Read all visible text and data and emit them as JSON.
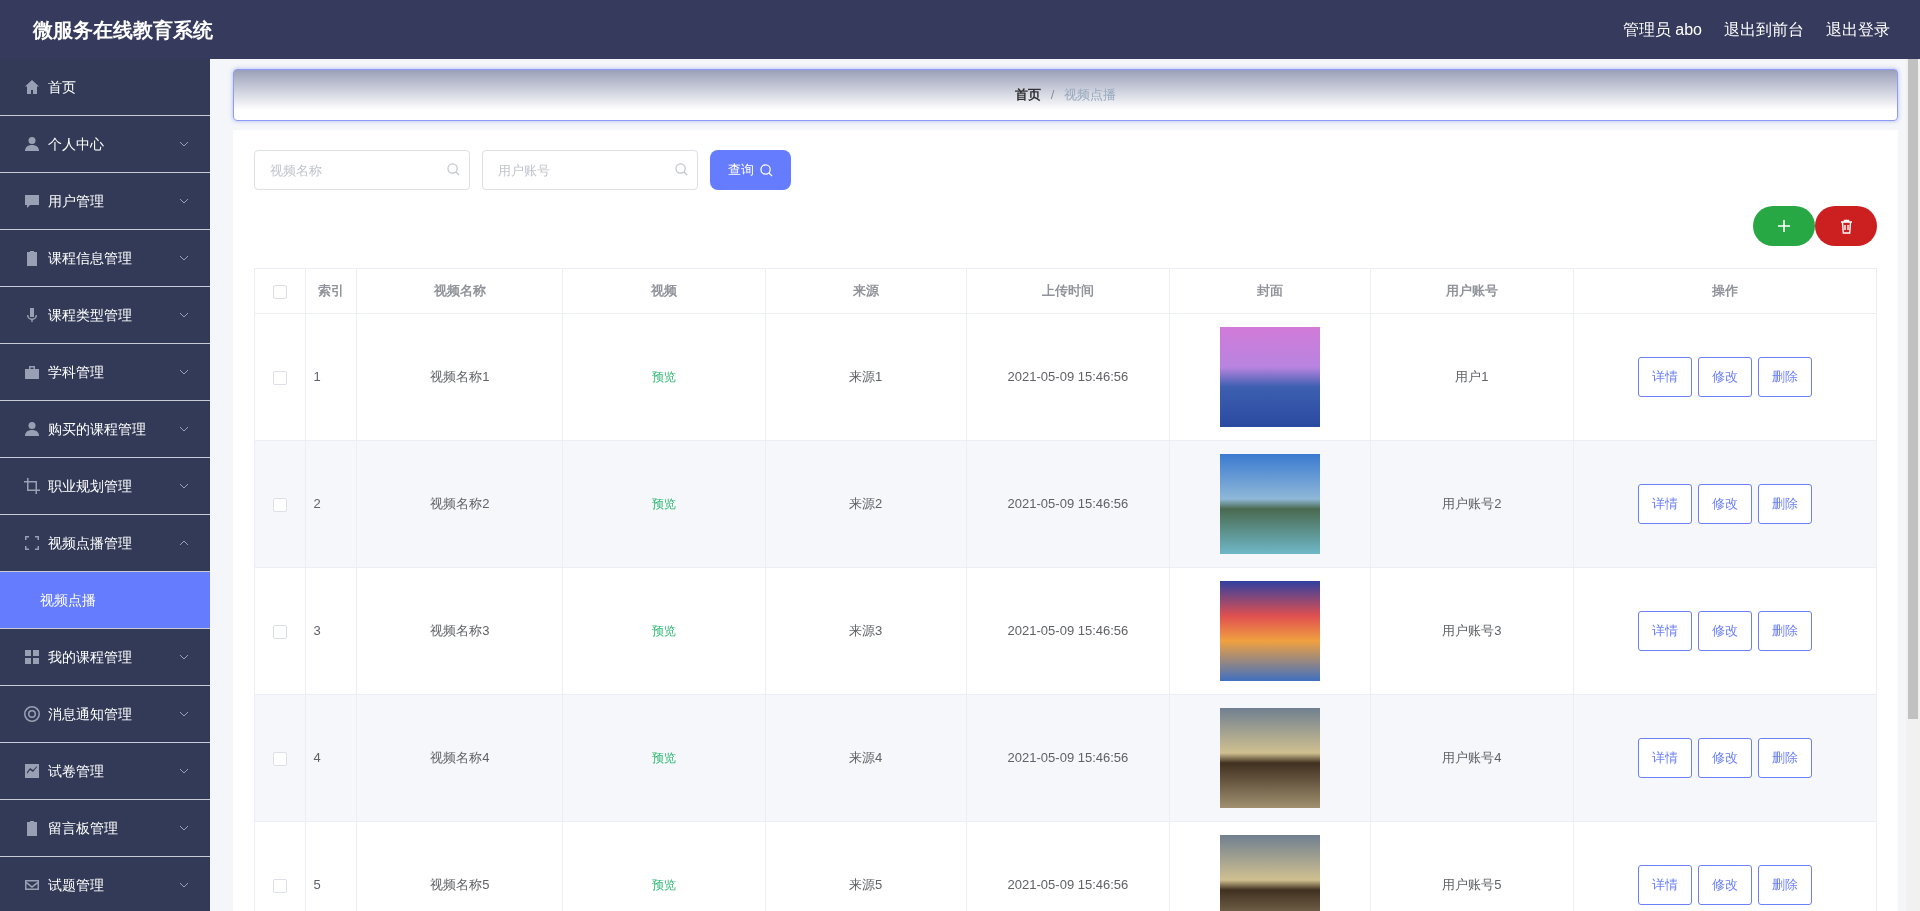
{
  "header": {
    "title": "微服务在线教育系统",
    "links": [
      {
        "label": "管理员 abo"
      },
      {
        "label": "退出到前台"
      },
      {
        "label": "退出登录"
      }
    ]
  },
  "sidebar": {
    "items": [
      {
        "label": "首页"
      },
      {
        "label": "个人中心",
        "expanded": false
      },
      {
        "label": "用户管理",
        "expanded": false
      },
      {
        "label": "课程信息管理",
        "expanded": false
      },
      {
        "label": "课程类型管理",
        "expanded": false
      },
      {
        "label": "学科管理",
        "expanded": false
      },
      {
        "label": "购买的课程管理",
        "expanded": false
      },
      {
        "label": "职业规划管理",
        "expanded": false
      },
      {
        "label": "视频点播管理",
        "expanded": true,
        "children": [
          {
            "label": "视频点播",
            "selected": true
          }
        ]
      },
      {
        "label": "我的课程管理",
        "expanded": false
      },
      {
        "label": "消息通知管理",
        "expanded": false
      },
      {
        "label": "试卷管理",
        "expanded": false
      },
      {
        "label": "留言板管理",
        "expanded": false
      },
      {
        "label": "试题管理",
        "expanded": false
      }
    ]
  },
  "breadcrumb": [
    {
      "label": "首页"
    },
    {
      "label": "视频点播"
    }
  ],
  "breadcrumb_separator": "/",
  "search": {
    "fields": [
      {
        "placeholder": "视频名称"
      },
      {
        "placeholder": "用户账号"
      }
    ],
    "button": "查询"
  },
  "table": {
    "select_all": false,
    "columns": [
      "索引",
      "视频名称",
      "视频",
      "来源",
      "上传时间",
      "封面",
      "用户账号",
      "操作"
    ],
    "rows": [
      {
        "checked": false,
        "index": "1",
        "name": "视频名称1",
        "video": "预览",
        "source": "来源1",
        "time": "2021-05-09 15:46:56",
        "user": "用户1",
        "actions": [
          "详情",
          "修改",
          "删除"
        ]
      },
      {
        "checked": false,
        "index": "2",
        "name": "视频名称2",
        "video": "预览",
        "source": "来源2",
        "time": "2021-05-09 15:46:56",
        "user": "用户账号2",
        "actions": [
          "详情",
          "修改",
          "删除"
        ]
      },
      {
        "checked": false,
        "index": "3",
        "name": "视频名称3",
        "video": "预览",
        "source": "来源3",
        "time": "2021-05-09 15:46:56",
        "user": "用户账号3",
        "actions": [
          "详情",
          "修改",
          "删除"
        ]
      },
      {
        "checked": false,
        "index": "4",
        "name": "视频名称4",
        "video": "预览",
        "source": "来源4",
        "time": "2021-05-09 15:46:56",
        "user": "用户账号4",
        "actions": [
          "详情",
          "修改",
          "删除"
        ]
      },
      {
        "checked": false,
        "index": "5",
        "name": "视频名称5",
        "video": "预览",
        "source": "来源5",
        "time": "2021-05-09 15:46:56",
        "user": "用户账号5",
        "actions": [
          "详情",
          "修改",
          "删除"
        ]
      }
    ]
  }
}
